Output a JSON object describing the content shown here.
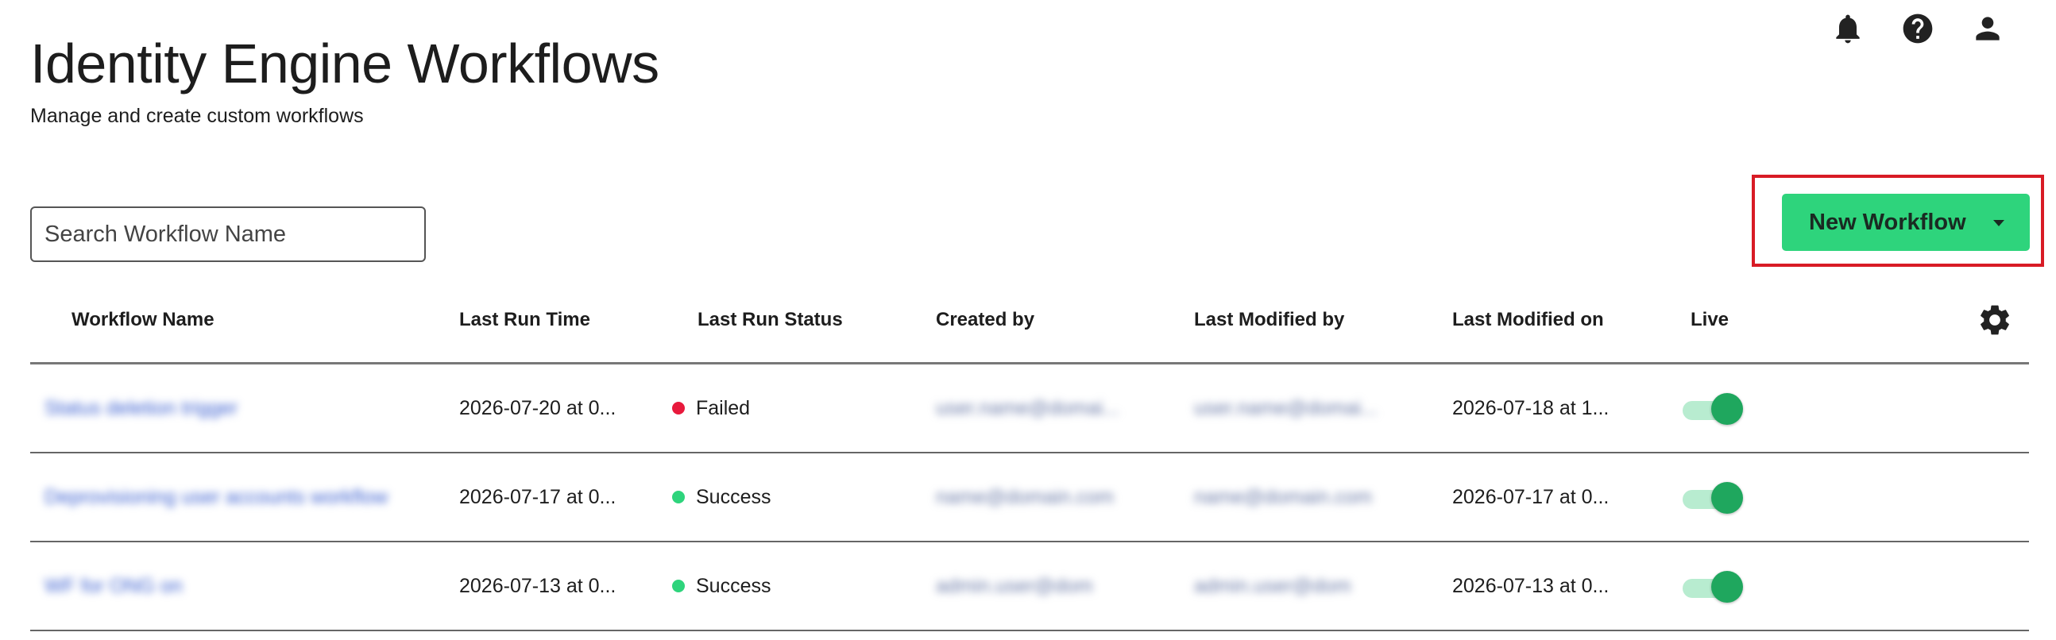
{
  "page": {
    "title": "Identity Engine Workflows",
    "subtitle": "Manage and create custom workflows"
  },
  "header_icons": [
    "bell-icon",
    "help-icon",
    "user-icon"
  ],
  "search": {
    "placeholder": "Search Workflow Name",
    "value": ""
  },
  "new_workflow_button": {
    "label": "New Workflow"
  },
  "table": {
    "columns": [
      "Workflow Name",
      "Last Run Time",
      "Last Run Status",
      "Created by",
      "Last Modified by",
      "Last Modified on",
      "Live"
    ],
    "rows": [
      {
        "name": "Status deletion trigger",
        "last_run_time": "2026-07-20 at 0...",
        "status": "Failed",
        "status_color": "#e8193c",
        "created_by": "user.name@domai...",
        "modified_by": "user.name@domai...",
        "modified_on": "2026-07-18 at 1...",
        "live": true
      },
      {
        "name": "Deprovisioning user accounts workflow",
        "last_run_time": "2026-07-17 at 0...",
        "status": "Success",
        "status_color": "#2ed47c",
        "created_by": "name@domain.com",
        "modified_by": "name@domain.com",
        "modified_on": "2026-07-17 at 0...",
        "live": true
      },
      {
        "name": "WF for ONG on",
        "last_run_time": "2026-07-13 at 0...",
        "status": "Success",
        "status_color": "#2ed47c",
        "created_by": "admin.user@dom",
        "modified_by": "admin.user@dom",
        "modified_on": "2026-07-13 at 0...",
        "live": true
      }
    ]
  },
  "colors": {
    "accent": "#2ed47c",
    "highlight": "#d81b25",
    "toggle_on": "#1fa75e"
  }
}
